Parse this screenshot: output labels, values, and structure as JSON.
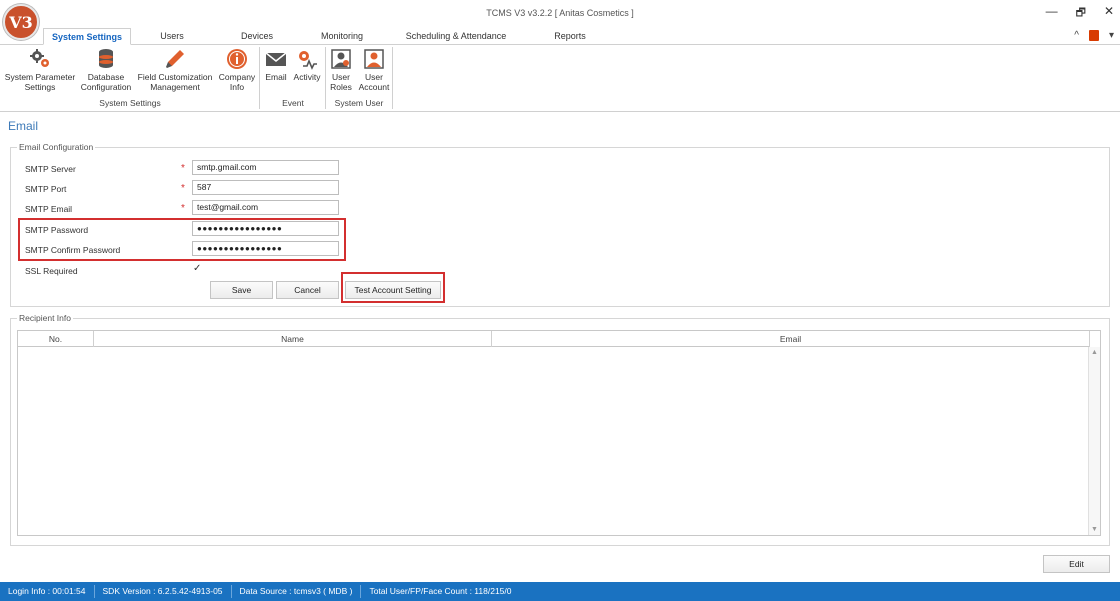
{
  "app": {
    "logo_text": "V3",
    "window_title": "TCMS V3 v3.2.2 [ Anitas Cosmetics ]"
  },
  "window_controls": {
    "minimize": "—",
    "restore": "🗗",
    "close": "✕"
  },
  "tabs": [
    {
      "label": "System Settings",
      "active": true
    },
    {
      "label": "Users"
    },
    {
      "label": "Devices"
    },
    {
      "label": "Monitoring"
    },
    {
      "label": "Scheduling & Attendance"
    },
    {
      "label": "Reports"
    }
  ],
  "tab_right": {
    "collapse": "^",
    "options": "▾"
  },
  "ribbon": {
    "groups": [
      {
        "label": "System Settings",
        "buttons": [
          {
            "label": "System Parameter Settings",
            "icon": "gears-icon"
          },
          {
            "label": "Database Configuration",
            "icon": "database-icon"
          },
          {
            "label": "Field Customization Management",
            "icon": "pencil-icon"
          },
          {
            "label": "Company Info",
            "icon": "info-icon"
          }
        ]
      },
      {
        "label": "Event",
        "buttons": [
          {
            "label": "Email",
            "icon": "envelope-icon"
          },
          {
            "label": "Activity",
            "icon": "activity-icon"
          }
        ]
      },
      {
        "label": "System User",
        "buttons": [
          {
            "label": "User Roles",
            "icon": "user-roles-icon"
          },
          {
            "label": "User Account",
            "icon": "user-account-icon"
          }
        ]
      }
    ]
  },
  "page": {
    "title": "Email",
    "email_config": {
      "legend": "Email Configuration",
      "smtp_server": {
        "label": "SMTP Server",
        "value": "smtp.gmail.com"
      },
      "smtp_port": {
        "label": "SMTP Port",
        "value": "587"
      },
      "smtp_email": {
        "label": "SMTP Email",
        "value": "test@gmail.com"
      },
      "smtp_password": {
        "label": "SMTP Password",
        "value": "●●●●●●●●●●●●●●●●"
      },
      "smtp_confirm_password": {
        "label": "SMTP Confirm Password",
        "value": "●●●●●●●●●●●●●●●●"
      },
      "ssl_required": {
        "label": "SSL Required",
        "checked": true,
        "mark": "✓"
      },
      "required_mark": "*",
      "save_label": "Save",
      "cancel_label": "Cancel",
      "test_label": "Test Account Setting"
    },
    "recipient_info": {
      "legend": "Recipient Info",
      "columns": [
        "No.",
        "Name",
        "Email"
      ],
      "rows": []
    },
    "edit_label": "Edit"
  },
  "statusbar": [
    "Login Info : 00:01:54",
    "SDK Version : 6.2.5.42-4913-05",
    "Data Source : tcmsv3 ( MDB )",
    "Total User/FP/Face Count : 118/215/0"
  ],
  "colors": {
    "accent": "#1565c0",
    "statusbar": "#1a72c1",
    "highlight": "#d32f2f",
    "logo": "#c9512c",
    "icon_orange": "#e0602e"
  }
}
